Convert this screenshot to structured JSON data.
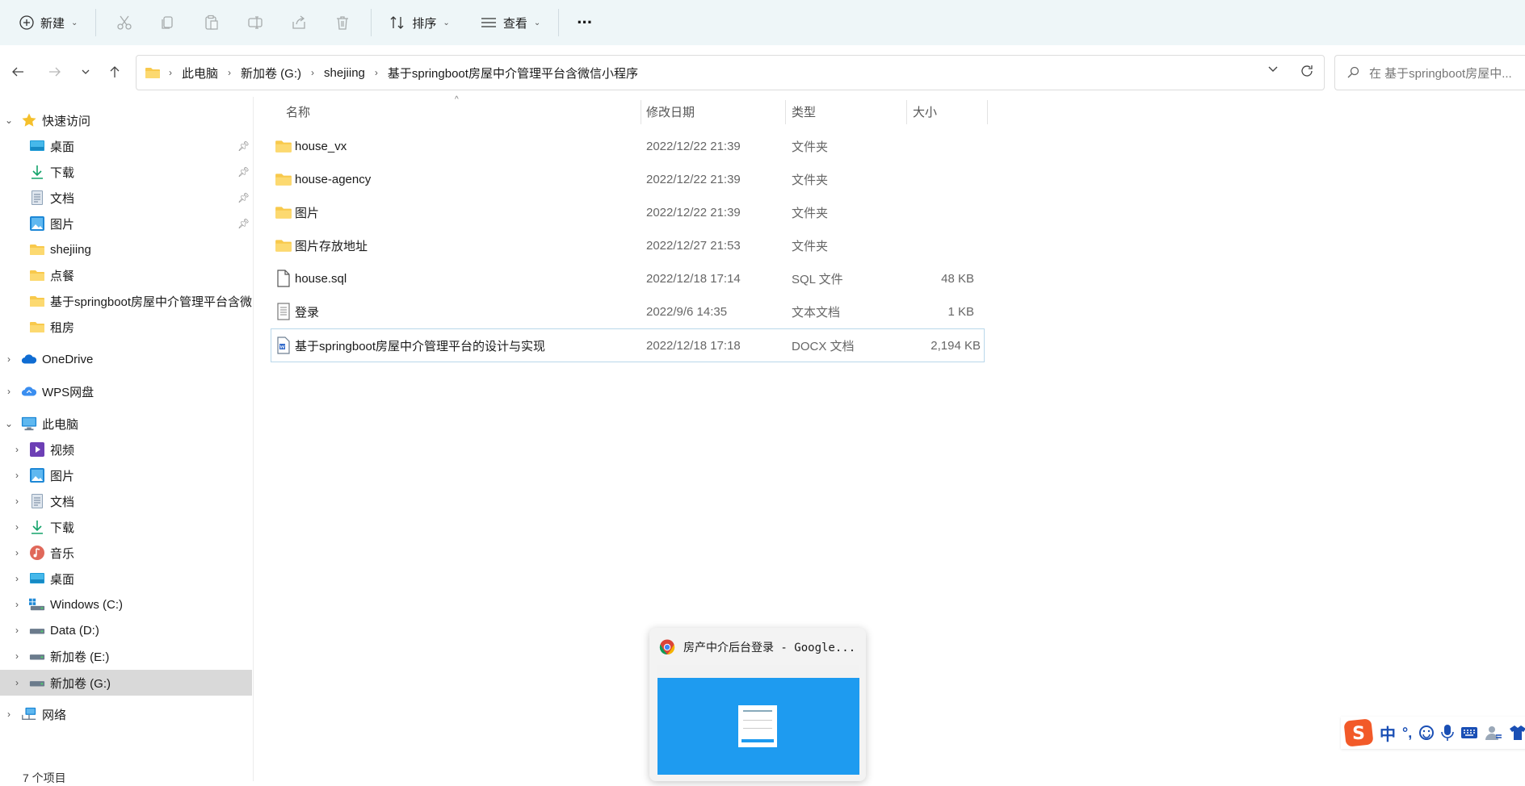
{
  "toolbar": {
    "new_label": "新建",
    "sort_label": "排序",
    "view_label": "查看",
    "more_label": "···"
  },
  "address": {
    "crumbs": [
      "此电脑",
      "新加卷 (G:)",
      "shejiing",
      "基于springboot房屋中介管理平台含微信小程序"
    ],
    "search_placeholder": "在 基于springboot房屋中..."
  },
  "sidebar": {
    "quick_access": {
      "label": "快速访问",
      "items": [
        {
          "label": "桌面",
          "pinned": true,
          "icon": "desktop-icon"
        },
        {
          "label": "下载",
          "pinned": true,
          "icon": "download-icon"
        },
        {
          "label": "文档",
          "pinned": true,
          "icon": "document-icon"
        },
        {
          "label": "图片",
          "pinned": true,
          "icon": "pictures-icon"
        },
        {
          "label": "shejiing",
          "pinned": false,
          "icon": "folder-icon"
        },
        {
          "label": "点餐",
          "pinned": false,
          "icon": "folder-icon"
        },
        {
          "label": "基于springboot房屋中介管理平台含微",
          "pinned": false,
          "icon": "folder-icon"
        },
        {
          "label": "租房",
          "pinned": false,
          "icon": "folder-icon"
        }
      ]
    },
    "onedrive": "OneDrive",
    "wps": "WPS网盘",
    "this_pc": {
      "label": "此电脑",
      "items": [
        {
          "label": "视频",
          "icon": "video-icon"
        },
        {
          "label": "图片",
          "icon": "pictures-icon"
        },
        {
          "label": "文档",
          "icon": "document-icon"
        },
        {
          "label": "下载",
          "icon": "download-icon"
        },
        {
          "label": "音乐",
          "icon": "music-icon"
        },
        {
          "label": "桌面",
          "icon": "desktop-icon"
        },
        {
          "label": "Windows (C:)",
          "icon": "drive-icon"
        },
        {
          "label": "Data (D:)",
          "icon": "drive-icon"
        },
        {
          "label": "新加卷 (E:)",
          "icon": "drive-icon"
        },
        {
          "label": "新加卷 (G:)",
          "icon": "drive-icon",
          "selected": true
        }
      ]
    },
    "network": "网络"
  },
  "columns": {
    "name": "名称",
    "date": "修改日期",
    "type": "类型",
    "size": "大小"
  },
  "files": [
    {
      "name": "house_vx",
      "date": "2022/12/22 21:39",
      "type": "文件夹",
      "size": "",
      "icon": "folder-icon"
    },
    {
      "name": "house-agency",
      "date": "2022/12/22 21:39",
      "type": "文件夹",
      "size": "",
      "icon": "folder-icon"
    },
    {
      "name": "图片",
      "date": "2022/12/22 21:39",
      "type": "文件夹",
      "size": "",
      "icon": "folder-icon"
    },
    {
      "name": "图片存放地址",
      "date": "2022/12/27 21:53",
      "type": "文件夹",
      "size": "",
      "icon": "folder-icon"
    },
    {
      "name": "house.sql",
      "date": "2022/12/18 17:14",
      "type": "SQL 文件",
      "size": "48 KB",
      "icon": "file-icon"
    },
    {
      "name": "登录",
      "date": "2022/9/6 14:35",
      "type": "文本文档",
      "size": "1 KB",
      "icon": "text-file-icon"
    },
    {
      "name": "基于springboot房屋中介管理平台的设计与实现",
      "date": "2022/12/18 17:18",
      "type": "DOCX 文档",
      "size": "2,194 KB",
      "icon": "docx-icon"
    }
  ],
  "status": {
    "count": "7 个项目"
  },
  "taskbar_preview": {
    "title": "房产中介后台登录 - Google..."
  },
  "ime": {
    "mode": "中",
    "punct": "°,"
  },
  "colors": {
    "accent": "#0a64d6",
    "toolbar_bg": "#eef6f8",
    "preview_blue": "#1e9bf0",
    "selected_row": "#d9d9d9"
  }
}
